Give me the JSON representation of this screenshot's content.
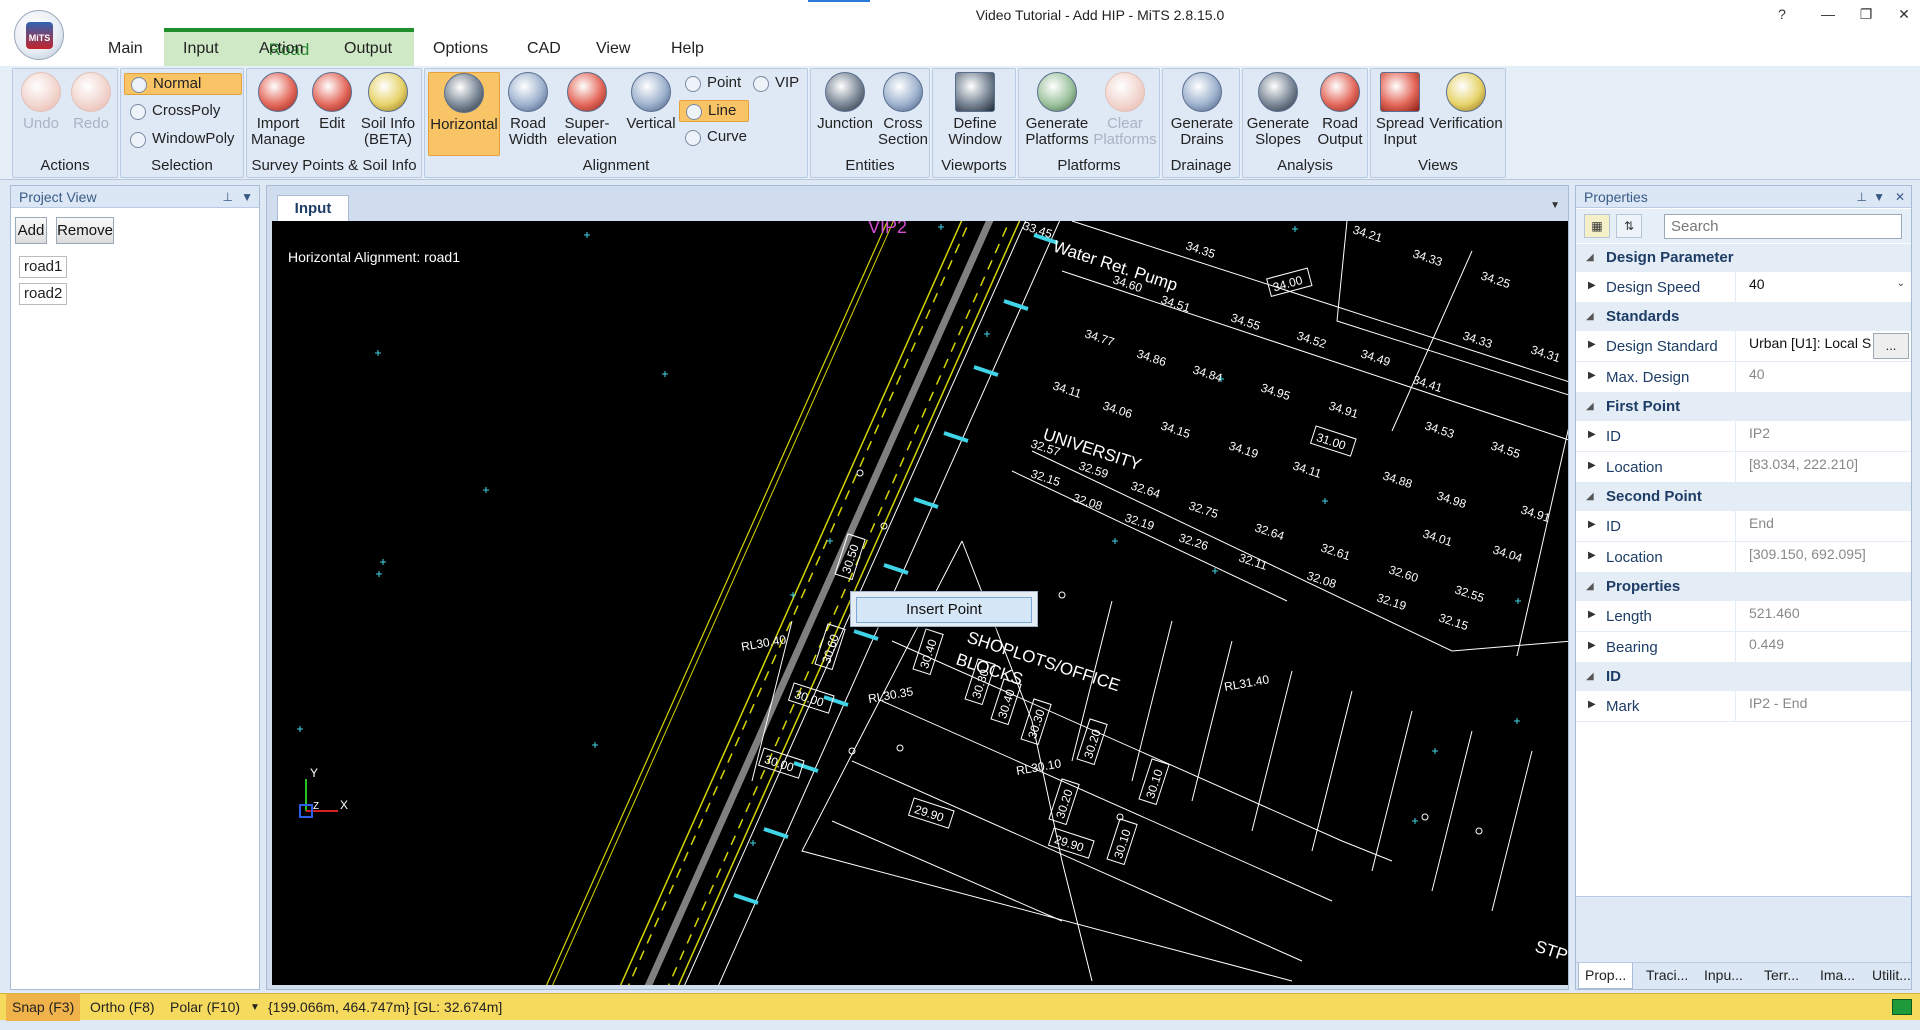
{
  "window": {
    "title": "Video Tutorial - Add HIP - MiTS 2.8.15.0",
    "logo_text": "MiTS"
  },
  "window_controls": {
    "help": "?",
    "minimize": "—",
    "restore": "❐",
    "close": "✕"
  },
  "context_tab": {
    "label": "Road"
  },
  "tabs": [
    "Main",
    "Input",
    "Action",
    "Output",
    "Options",
    "CAD",
    "View",
    "Help"
  ],
  "ribbon": {
    "actions": {
      "label": "Actions",
      "undo": "Undo",
      "redo": "Redo"
    },
    "selection": {
      "label": "Selection",
      "normal": "Normal",
      "crosspoly": "CrossPoly",
      "windowpoly": "WindowPoly"
    },
    "survey": {
      "label": "Survey Points & Soil Info",
      "import_1": "Import",
      "import_2": "Manage",
      "edit": "Edit",
      "soil_1": "Soil Info",
      "soil_2": "(BETA)"
    },
    "alignment": {
      "label": "Alignment",
      "horizontal": "Horizontal",
      "road_1": "Road",
      "road_2": "Width",
      "super_1": "Super-",
      "super_2": "elevation",
      "vertical": "Vertical",
      "point": "Point",
      "vip": "VIP",
      "line": "Line",
      "curve": "Curve"
    },
    "entities": {
      "label": "Entities",
      "junction": "Junction",
      "cross_1": "Cross",
      "cross_2": "Section"
    },
    "viewports": {
      "label": "Viewports",
      "define_1": "Define",
      "define_2": "Window"
    },
    "platforms": {
      "label": "Platforms",
      "gen_1": "Generate",
      "gen_2": "Platforms",
      "clear_1": "Clear",
      "clear_2": "Platforms"
    },
    "drainage": {
      "label": "Drainage",
      "gen_1": "Generate",
      "gen_2": "Drains"
    },
    "analysis": {
      "label": "Analysis",
      "slopes_1": "Generate",
      "slopes_2": "Slopes",
      "road_1": "Road",
      "road_2": "Output"
    },
    "views": {
      "label": "Views",
      "spread_1": "Spread",
      "spread_2": "Input",
      "verification": "Verification"
    }
  },
  "project_view": {
    "title": "Project View",
    "add": "Add",
    "remove": "Remove",
    "items": [
      "road1",
      "road2"
    ]
  },
  "document": {
    "tab": "Input",
    "caption": "Horizontal Alignment: road1",
    "context_menu": {
      "item": "Insert Point"
    },
    "cad_labels": {
      "vip": "VIP2",
      "water": "Water Ret. Pump",
      "university": "UNIVERSITY",
      "shoplots": "SHOPLOTS/OFFICE",
      "blocks": "BLOCKS",
      "stp": "STP",
      "rl_a": "RL30.40",
      "rl_b": "RL30.35",
      "rl_c": "RL30.10",
      "rl_d": "RL31.40",
      "levels": [
        "33.45",
        "34.35",
        "34.21",
        "34.33",
        "34.25",
        "34.60",
        "34.51",
        "34.55",
        "34.52",
        "34.49",
        "34.41",
        "34.33",
        "34.31",
        "34.77",
        "34.86",
        "34.84",
        "34.95",
        "34.91",
        "34.53",
        "34.55",
        "34.11",
        "34.06",
        "34.15",
        "34.19",
        "34.11",
        "34.88",
        "34.98",
        "34.91",
        "32.57",
        "32.59",
        "32.64",
        "32.75",
        "32.64",
        "32.61",
        "32.60",
        "32.55",
        "34.01",
        "34.04",
        "32.15",
        "32.08",
        "32.19",
        "32.26",
        "32.11",
        "32.08",
        "32.19",
        "32.15"
      ],
      "boxes": [
        "34.00",
        "31.00",
        "30.50",
        "30.60",
        "30.40",
        "30.30",
        "30.40",
        "30.30",
        "30.20",
        "30.20",
        "30.10",
        "30.10",
        "30.00",
        "30.00",
        "29.90",
        "29.90"
      ],
      "ortho": {
        "y": "Y",
        "x": "X",
        "z": "Z"
      }
    }
  },
  "properties": {
    "title": "Properties",
    "search_placeholder": "Search",
    "categories": [
      {
        "name": "Design Parameter",
        "rows": [
          {
            "name": "Design Speed",
            "value": "40",
            "editable": true,
            "dropdown": true
          }
        ]
      },
      {
        "name": "Standards",
        "rows": [
          {
            "name": "Design Standard",
            "value": "Urban [U1]: Local S",
            "editable": true,
            "ellipsis": "..."
          },
          {
            "name": "Max. Design Speed",
            "value": "40"
          }
        ]
      },
      {
        "name": "First Point",
        "rows": [
          {
            "name": "ID",
            "value": "IP2"
          },
          {
            "name": "Location",
            "value": "[83.034, 222.210]"
          }
        ]
      },
      {
        "name": "Second Point",
        "rows": [
          {
            "name": "ID",
            "value": "End"
          },
          {
            "name": "Location",
            "value": "[309.150, 692.095]"
          }
        ]
      },
      {
        "name": "Properties",
        "rows": [
          {
            "name": "Length",
            "value": "521.460"
          },
          {
            "name": "Bearing",
            "value": "0.449"
          }
        ]
      },
      {
        "name": "ID",
        "rows": [
          {
            "name": "Mark",
            "value": "IP2 - End"
          }
        ]
      }
    ],
    "tabs": [
      "Prop...",
      "Traci...",
      "Inpu...",
      "Terr...",
      "Ima...",
      "Utilit..."
    ]
  },
  "status": {
    "snap": "Snap (F3)",
    "ortho": "Ortho (F8)",
    "polar": "Polar (F10)",
    "coords": "{199.066m, 464.747m} [GL: 32.674m]"
  }
}
